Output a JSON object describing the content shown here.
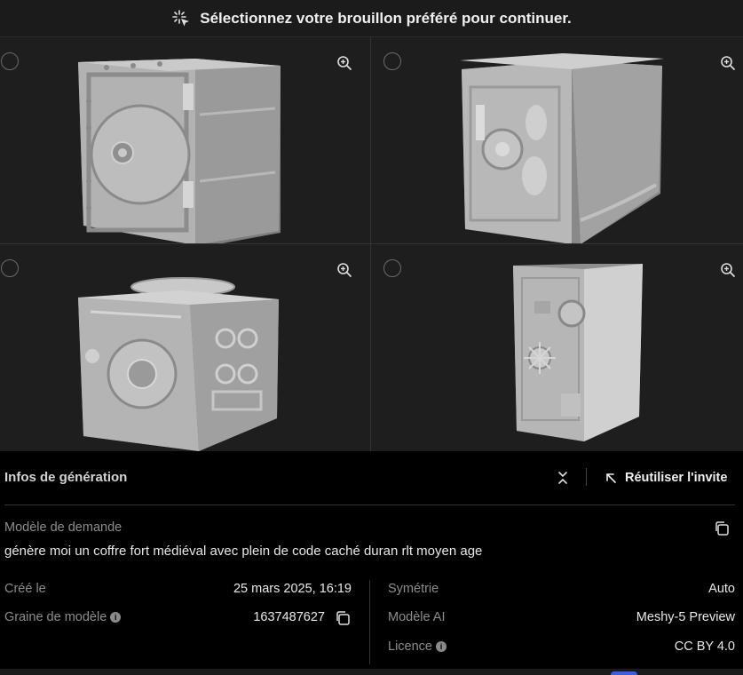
{
  "header": {
    "title": "Sélectionnez votre brouillon préféré pour continuer."
  },
  "drafts": [
    {
      "id": "draft-1",
      "icon": "zoom-in-icon"
    },
    {
      "id": "draft-2",
      "icon": "zoom-in-icon"
    },
    {
      "id": "draft-3",
      "icon": "zoom-in-icon"
    },
    {
      "id": "draft-4",
      "icon": "zoom-in-icon"
    }
  ],
  "info": {
    "title": "Infos de génération",
    "reuse_label": "Réutiliser l'invite",
    "prompt_label": "Modèle de demande",
    "prompt_text": "génère moi un coffre fort médiéval avec plein de code caché duran rlt moyen age",
    "left": {
      "created_label": "Créé le",
      "created_value": "25 mars 2025, 16:19",
      "seed_label": "Graine de modèle",
      "seed_value": "1637487627"
    },
    "right": {
      "symmetry_label": "Symétrie",
      "symmetry_value": "Auto",
      "model_label": "Modèle AI",
      "model_value": "Meshy-5 Preview",
      "license_label": "Licence",
      "license_value": "CC BY 4.0"
    }
  },
  "colors": {
    "panel_bg": "#1e1e1e",
    "info_bg": "#000000",
    "model_gray": "#a9a9a9",
    "accent_blue": "#3b5fd9"
  }
}
